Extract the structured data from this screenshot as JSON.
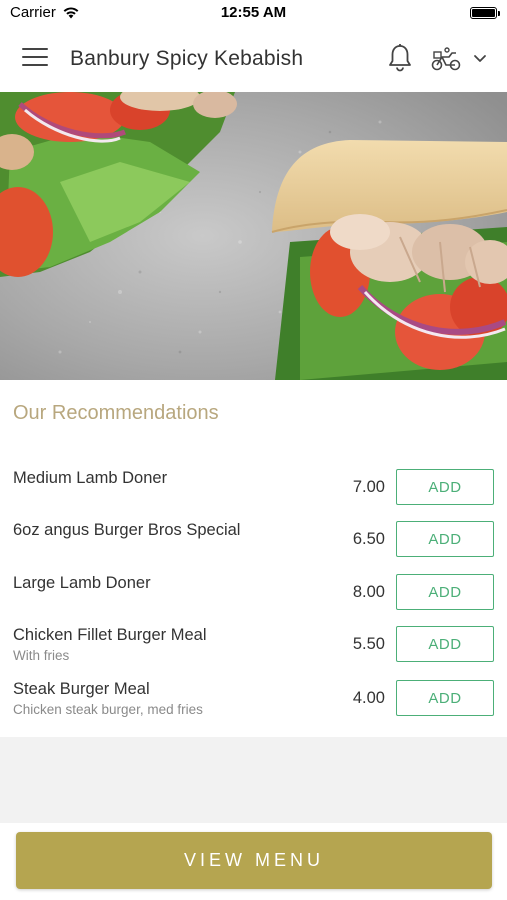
{
  "status_bar": {
    "carrier": "Carrier",
    "time": "12:55 AM"
  },
  "header": {
    "title": "Banbury Spicy Kebabish",
    "icons": [
      "menu-icon",
      "bell-icon",
      "delivery-scooter-icon",
      "chevron-down-icon"
    ]
  },
  "recommendations": {
    "title": "Our Recommendations",
    "items": [
      {
        "name": "Medium Lamb Doner",
        "description": "",
        "price": "7.00",
        "button": "ADD"
      },
      {
        "name": "6oz angus Burger Bros Special",
        "description": "",
        "price": "6.50",
        "button": "ADD"
      },
      {
        "name": "Large Lamb Doner",
        "description": "",
        "price": "8.00",
        "button": "ADD"
      },
      {
        "name": "Chicken Fillet Burger Meal",
        "description": "With fries",
        "price": "5.50",
        "button": "ADD"
      },
      {
        "name": "Steak Burger Meal",
        "description": "Chicken steak burger, med fries",
        "price": "4.00",
        "button": "ADD"
      }
    ]
  },
  "footer": {
    "view_menu_label": "VIEW MENU"
  },
  "colors": {
    "accent_gold": "#b5a550",
    "section_title": "#b8a77e",
    "add_green": "#4caf78"
  }
}
